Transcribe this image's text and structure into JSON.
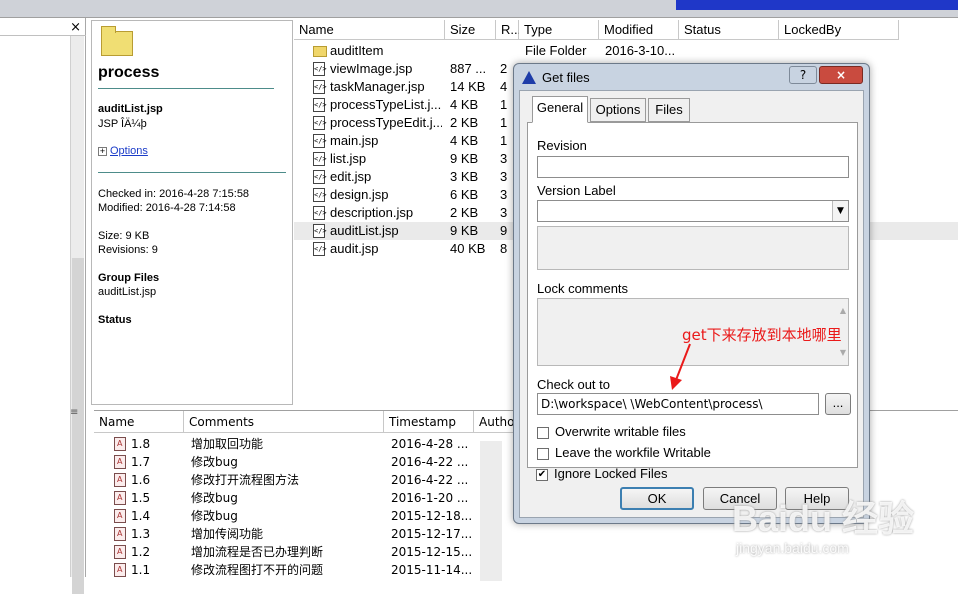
{
  "window": {
    "close_glyph": "×",
    "splitter_glyph": "≡"
  },
  "info": {
    "folder_name": "process",
    "file_name": "auditList.jsp",
    "file_type": "JSP ÎÄ¼þ",
    "options_label": "Options",
    "checked_in": "Checked in: 2016-4-28 7:15:58",
    "modified": "Modified: 2016-4-28 7:14:58",
    "size": "Size: 9 KB",
    "revisions": "Revisions: 9",
    "group_files_title": "Group Files",
    "group_files_value": "auditList.jsp",
    "status_title": "Status"
  },
  "file_list": {
    "columns": [
      "Name",
      "Size",
      "R...",
      "Type",
      "Modified",
      "Status",
      "LockedBy"
    ],
    "rows": [
      {
        "icon": "folder-icon",
        "name": "auditItem",
        "size": "",
        "rev": "",
        "type": "File Folder",
        "modified": "2016-3-10..."
      },
      {
        "icon": "jsp-file-icon",
        "name": "viewImage.jsp",
        "size": "887 ...",
        "rev": "2",
        "type": "",
        "modified": ""
      },
      {
        "icon": "jsp-file-icon",
        "name": "taskManager.jsp",
        "size": "14 KB",
        "rev": "4",
        "type": "",
        "modified": ""
      },
      {
        "icon": "jsp-file-icon",
        "name": "processTypeList.j...",
        "size": "4 KB",
        "rev": "1",
        "type": "",
        "modified": ""
      },
      {
        "icon": "jsp-file-icon",
        "name": "processTypeEdit.j...",
        "size": "2 KB",
        "rev": "1",
        "type": "",
        "modified": ""
      },
      {
        "icon": "jsp-file-icon",
        "name": "main.jsp",
        "size": "4 KB",
        "rev": "1",
        "type": "",
        "modified": ""
      },
      {
        "icon": "jsp-file-icon",
        "name": "list.jsp",
        "size": "9 KB",
        "rev": "3",
        "type": "",
        "modified": ""
      },
      {
        "icon": "jsp-file-icon",
        "name": "edit.jsp",
        "size": "3 KB",
        "rev": "3",
        "type": "",
        "modified": ""
      },
      {
        "icon": "jsp-file-icon",
        "name": "design.jsp",
        "size": "6 KB",
        "rev": "3",
        "type": "",
        "modified": ""
      },
      {
        "icon": "jsp-file-icon",
        "name": "description.jsp",
        "size": "2 KB",
        "rev": "3",
        "type": "",
        "modified": ""
      },
      {
        "icon": "jsp-file-icon",
        "name": "auditList.jsp",
        "size": "9 KB",
        "rev": "9",
        "type": "",
        "modified": "",
        "selected": true
      },
      {
        "icon": "jsp-file-icon",
        "name": "audit.jsp",
        "size": "40 KB",
        "rev": "8",
        "type": "",
        "modified": ""
      }
    ]
  },
  "history": {
    "columns": [
      "Name",
      "Comments",
      "Timestamp",
      "Autho"
    ],
    "rows": [
      {
        "name": "1.8",
        "comment": "增加取回功能",
        "timestamp": "2016-4-28 ..."
      },
      {
        "name": "1.7",
        "comment": "修改bug",
        "timestamp": "2016-4-22 ..."
      },
      {
        "name": "1.6",
        "comment": "修改打开流程图方法",
        "timestamp": "2016-4-22 ..."
      },
      {
        "name": "1.5",
        "comment": "修改bug",
        "timestamp": "2016-1-20 ..."
      },
      {
        "name": "1.4",
        "comment": "修改bug",
        "timestamp": "2015-12-18..."
      },
      {
        "name": "1.3",
        "comment": "增加传阅功能",
        "timestamp": "2015-12-17..."
      },
      {
        "name": "1.2",
        "comment": "增加流程是否已办理判断",
        "timestamp": "2015-12-15..."
      },
      {
        "name": "1.1",
        "comment": "修改流程图打不开的问题",
        "timestamp": "2015-11-14..."
      }
    ]
  },
  "dialog": {
    "title": "Get files",
    "help_glyph": "?",
    "close_glyph": "×",
    "tabs": [
      "General",
      "Options",
      "Files"
    ],
    "active_tab": "General",
    "revision_label": "Revision",
    "revision_value": "",
    "version_label_label": "Version Label",
    "version_label_value": "",
    "lock_comments_label": "Lock comments",
    "checkout_label": "Check out to",
    "checkout_path": "D:\\workspace\\      \\WebContent\\process\\",
    "browse_label": "...",
    "options": [
      {
        "label": "Overwrite writable files",
        "checked": false
      },
      {
        "label": "Leave the workfile Writable",
        "checked": false
      },
      {
        "label": "Ignore Locked Files",
        "checked": true
      }
    ],
    "ok_label": "OK",
    "cancel_label": "Cancel",
    "help_label": "Help"
  },
  "annotation": {
    "text": "get下来存放到本地哪里",
    "color": "#ea1a1a"
  },
  "watermark": {
    "text": "Baidu 经验",
    "url": "jingyan.baidu.com"
  }
}
